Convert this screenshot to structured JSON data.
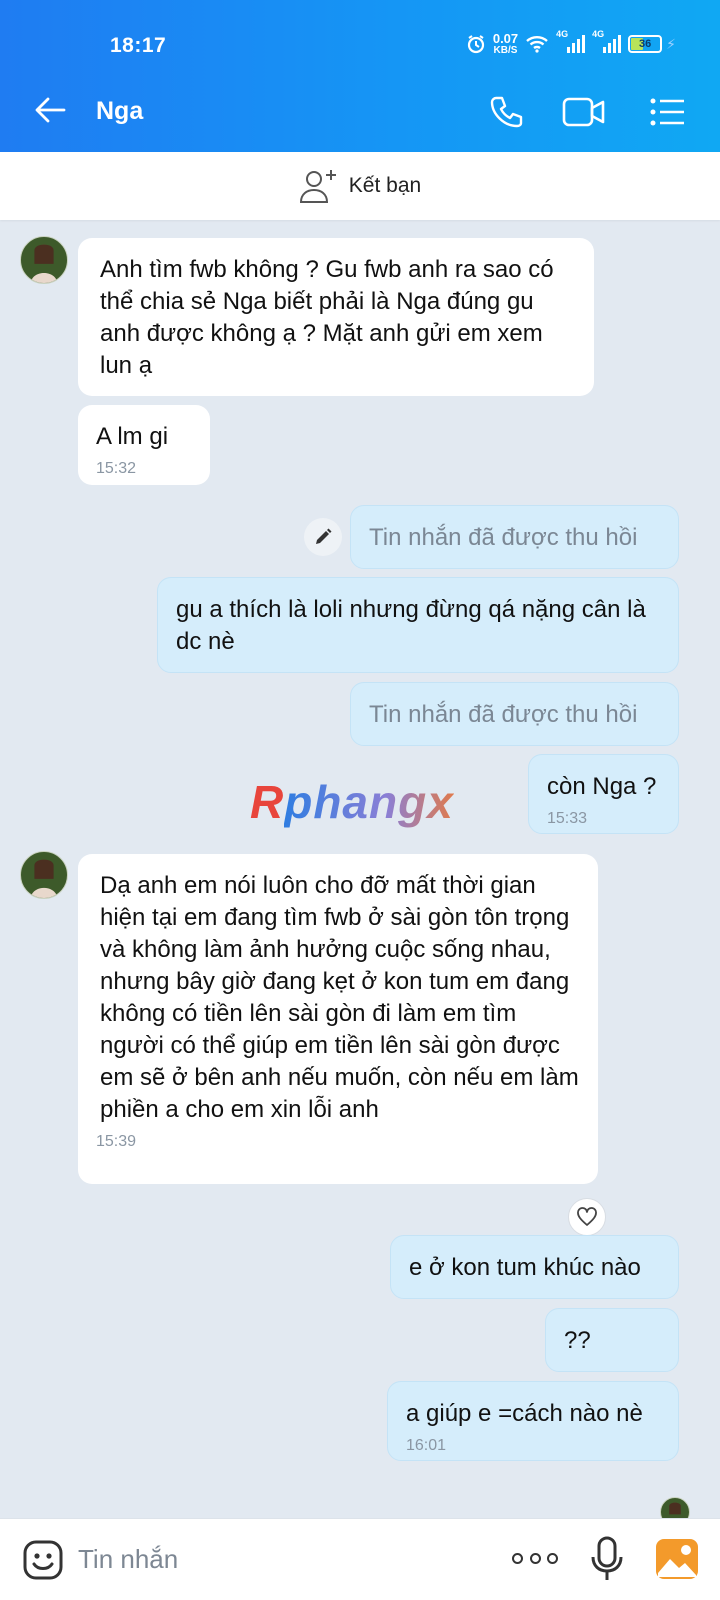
{
  "status_bar": {
    "time": "18:17",
    "net_speed_value": "0.07",
    "net_speed_unit": "KB/S",
    "signal1_label": "4G",
    "signal2_label": "4G",
    "battery": "36"
  },
  "header": {
    "contact_name": "Nga",
    "icons": [
      "back-arrow-icon",
      "phone-icon",
      "video-call-icon",
      "menu-list-icon"
    ]
  },
  "friend_bar": {
    "label": "Kết bạn"
  },
  "messages": [
    {
      "dir": "in",
      "text": "Anh tìm fwb không ? Gu fwb anh ra sao có thể chia sẻ Nga biết phải là Nga đúng gu anh được không ạ ? Mặt anh gửi em xem lun ạ",
      "time": ""
    },
    {
      "dir": "in",
      "text": "A lm gi",
      "time": "15:32"
    },
    {
      "dir": "out",
      "text": "Tin nhắn đã được thu hồi",
      "time": "",
      "recalled": true
    },
    {
      "dir": "out",
      "text": "gu a thích là loli nhưng đừng qá nặng cân là dc nè",
      "time": ""
    },
    {
      "dir": "out",
      "text": "Tin nhắn đã được thu hồi",
      "time": "",
      "recalled": true
    },
    {
      "dir": "out",
      "text": "còn Nga ?",
      "time": "15:33"
    },
    {
      "dir": "in",
      "text": "Dạ anh em nói luôn cho đỡ mất thời gian hiện tại em đang tìm fwb ở sài gòn tôn trọng và không làm ảnh hưởng cuộc sống nhau, nhưng bây giờ đang kẹt ở kon tum em đang không có tiền lên sài gòn đi làm em tìm người có thể giúp em tiền lên sài gòn được em sẽ ở bên anh nếu muốn, còn nếu em làm phiền a cho em xin lỗi anh",
      "time": "15:39"
    },
    {
      "dir": "out",
      "text": "e ở kon tum khúc nào",
      "time": ""
    },
    {
      "dir": "out",
      "text": "??",
      "time": ""
    },
    {
      "dir": "out",
      "text": "a giúp e =cách nào nè",
      "time": "16:01"
    }
  ],
  "watermark": {
    "first": "R",
    "rest": "phangx"
  },
  "input_bar": {
    "placeholder": "Tin nhắn"
  },
  "colors": {
    "header_start": "#1f7cf2",
    "header_end": "#10a8f3",
    "outgoing_bubble": "#d5edfb",
    "incoming_bubble": "#ffffff",
    "chat_bg": "#e2e9f1"
  }
}
